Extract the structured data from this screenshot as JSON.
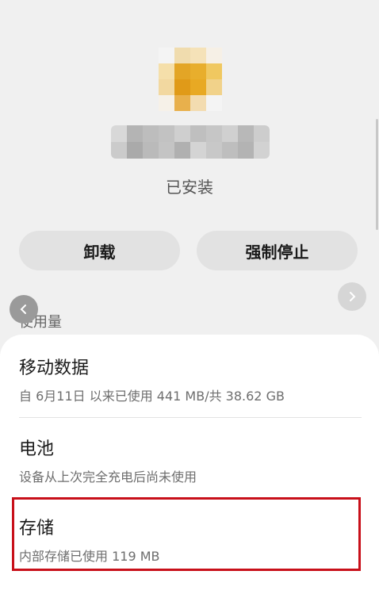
{
  "app": {
    "install_status": "已安装"
  },
  "actions": {
    "uninstall_label": "卸载",
    "force_stop_label": "强制停止"
  },
  "usage": {
    "section_title": "使用量",
    "mobile_data": {
      "title": "移动数据",
      "subtitle": "自 6月11日 以来已使用 441 MB/共 38.62 GB"
    },
    "battery": {
      "title": "电池",
      "subtitle": "设备从上次完全充电后尚未使用"
    },
    "storage": {
      "title": "存储",
      "subtitle": "内部存储已使用 119 MB"
    }
  },
  "icons": {
    "left": "chevron-left-icon",
    "right": "chevron-right-icon"
  },
  "colors": {
    "highlight_border": "#c8101a",
    "button_bg": "#e2e2e2",
    "page_bg": "#f0f0f0"
  }
}
